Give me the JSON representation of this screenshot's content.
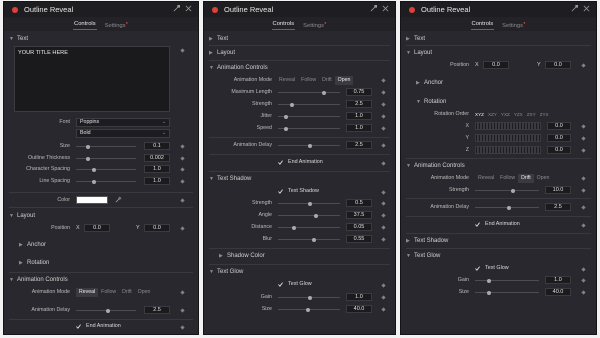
{
  "window_title": "Outline Reveal",
  "tabs": {
    "controls": "Controls",
    "settings": "Settings"
  },
  "p1": {
    "text_header": "Text",
    "text_value": "YOUR TITLE HERE",
    "font_label": "Font",
    "font_value": "Poppins",
    "style_value": "Bold",
    "size_label": "Size",
    "size_value": "0.1",
    "thickness_label": "Outline Thickness",
    "thickness_value": "0.002",
    "charsp_label": "Character Spacing",
    "charsp_value": "1.0",
    "linesp_label": "Line Spacing",
    "linesp_value": "1.0",
    "color_label": "Color",
    "layout_header": "Layout",
    "position_label": "Position",
    "x_label": "X",
    "x_value": "0.0",
    "y_label": "Y",
    "y_value": "0.0",
    "anchor_header": "Anchor",
    "rotation_header": "Rotation",
    "anim_header": "Animation Controls",
    "mode_label": "Animation Mode",
    "modes": [
      "Reveal",
      "Follow",
      "Drift",
      "Open"
    ],
    "delay_label": "Animation Delay",
    "delay_value": "2.5",
    "end_anim_label": "End Animation"
  },
  "p2": {
    "text_header": "Text",
    "layout_header": "Layout",
    "anim_header": "Animation Controls",
    "mode_label": "Animation Mode",
    "modes": [
      "Reveal",
      "Follow",
      "Drift",
      "Open"
    ],
    "maxlen_label": "Maximum Length",
    "maxlen_value": "0.75",
    "strength_label": "Strength",
    "strength_value": "2.5",
    "jitter_label": "Jitter",
    "jitter_value": "1.0",
    "speed_label": "Speed",
    "speed_value": "1.0",
    "delay_label": "Animation Delay",
    "delay_value": "2.5",
    "end_anim_label": "End Animation",
    "shadow_header": "Text Shadow",
    "shadow_check": "Text Shadow",
    "sh_strength_label": "Strength",
    "sh_strength_value": "0.5",
    "angle_label": "Angle",
    "angle_value": "37.5",
    "distance_label": "Distance",
    "distance_value": "0.05",
    "blur_label": "Blur",
    "blur_value": "0.55",
    "shadow_color_header": "Shadow Color",
    "glow_header": "Text Glow",
    "glow_check": "Text Glow",
    "gain_label": "Gain",
    "gain_value": "1.0",
    "size_label": "Size",
    "size_value": "40.0"
  },
  "p3": {
    "text_header": "Text",
    "layout_header": "Layout",
    "position_label": "Position",
    "x_label": "X",
    "x_value": "0.0",
    "y_label": "Y",
    "y_value": "0.0",
    "anchor_header": "Anchor",
    "rotation_header": "Rotation",
    "rot_order_label": "Rotation Order",
    "rot_orders": [
      "XYZ",
      "XZY",
      "YXZ",
      "YZX",
      "ZXY",
      "ZYX"
    ],
    "rx_label": "X",
    "rx_value": "0.0",
    "ry_label": "Y",
    "ry_value": "0.0",
    "rz_label": "Z",
    "rz_value": "0.0",
    "anim_header": "Animation Controls",
    "mode_label": "Animation Mode",
    "modes": [
      "Reveal",
      "Follow",
      "Drift",
      "Open"
    ],
    "strength_label": "Strength",
    "strength_value": "10.0",
    "delay_label": "Animation Delay",
    "delay_value": "2.5",
    "end_anim_label": "End Animation",
    "shadow_header": "Text Shadow",
    "glow_header": "Text Glow",
    "glow_check": "Text Glow",
    "gain_label": "Gain",
    "gain_value": "1.0",
    "size_label": "Size",
    "size_value": "40.0"
  }
}
